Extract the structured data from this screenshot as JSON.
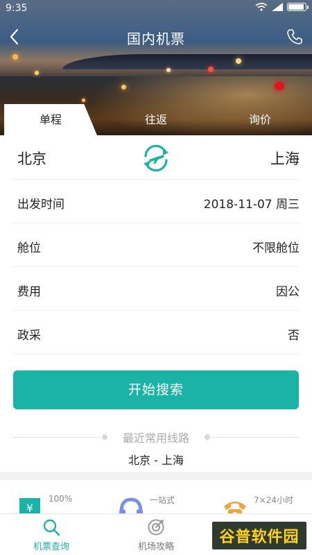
{
  "status_bar": {
    "time": "9:35"
  },
  "header": {
    "title": "国内机票"
  },
  "tabs": [
    {
      "label": "单程",
      "active": true
    },
    {
      "label": "往返",
      "active": false
    },
    {
      "label": "询价",
      "active": false
    }
  ],
  "route": {
    "from": "北京",
    "to": "上海"
  },
  "form_rows": [
    {
      "label": "出发时间",
      "value": "2018-11-07 周三"
    },
    {
      "label": "舱位",
      "value": "不限舱位"
    },
    {
      "label": "费用",
      "value": "因公"
    },
    {
      "label": "政采",
      "value": "否"
    }
  ],
  "search_button": {
    "label": "开始搜索"
  },
  "recent": {
    "title": "最近常用线路",
    "routes": [
      "北京 - 上海"
    ]
  },
  "features": [
    {
      "icon": "yuan-shield-icon",
      "text": "100%"
    },
    {
      "icon": "headset-icon",
      "text": "一站式"
    },
    {
      "icon": "telephone-icon",
      "text": "7×24小时"
    }
  ],
  "bottom_nav": [
    {
      "label": "机票查询",
      "icon": "search-icon",
      "active": true
    },
    {
      "label": "机场攻略",
      "icon": "compass-icon",
      "active": false
    }
  ],
  "watermark": {
    "text": "谷普软件园"
  },
  "colors": {
    "accent": "#1ab3a6",
    "divider": "#eeeeee"
  }
}
